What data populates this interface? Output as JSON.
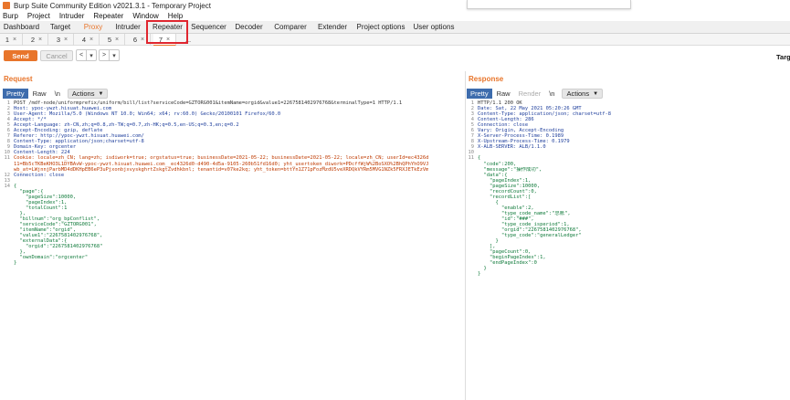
{
  "window": {
    "title": "Burp Suite Community Edition v2021.3.1 - Temporary Project"
  },
  "menu": [
    "Burp",
    "Project",
    "Intruder",
    "Repeater",
    "Window",
    "Help"
  ],
  "top_tabs": [
    {
      "label": "Dashboard"
    },
    {
      "label": "Target"
    },
    {
      "label": "Proxy"
    },
    {
      "label": "Intruder"
    },
    {
      "label": "Repeater"
    },
    {
      "label": "Sequencer"
    },
    {
      "label": "Decoder"
    },
    {
      "label": "Comparer"
    },
    {
      "label": "Extender"
    },
    {
      "label": "Project options"
    },
    {
      "label": "User options"
    }
  ],
  "repeater_tabs": [
    {
      "label": "1",
      "close": "×"
    },
    {
      "label": "2",
      "close": "×"
    },
    {
      "label": "3",
      "close": "×"
    },
    {
      "label": "4",
      "close": "×"
    },
    {
      "label": "5",
      "close": "×"
    },
    {
      "label": "6",
      "close": "×"
    },
    {
      "label": "7",
      "close": "×"
    },
    {
      "label": "...",
      "close": ""
    }
  ],
  "controls": {
    "send": "Send",
    "cancel": "Cancel",
    "back": "<",
    "back_menu": "▾",
    "forward": ">",
    "forward_menu": "▾",
    "target": "Targ"
  },
  "request": {
    "title": "Request",
    "tabs": [
      "Pretty",
      "Raw",
      "\\n"
    ],
    "actions": "Actions",
    "lines": [
      "POST /mdf-node/uniformprefix/uniform/bill/list?serviceCode=GZTORG001&itemName=orgid&value1=2267581402976768&terminalType=1 HTTP/1.1",
      "Host: ypoc-ywzt.hisuat.huawei.com",
      "User-Agent: Mozilla/5.0 (Windows NT 10.0; Win64; x64; rv:60.0) Gecko/20100101 Firefox/60.0",
      "Accept: */*",
      "Accept-Language: zh-CN,zh;q=0.8,zh-TW;q=0.7,zh-HK;q=0.5,en-US;q=0.3,en;q=0.2",
      "Accept-Encoding: gzip, deflate",
      "Referer: http://ypoc-ywzt.hisuat.huawei.com/",
      "Content-Type: application/json;charset=utf-8",
      "Domain-Key: orgcenter",
      "Content-Length: 224",
      "Cookie: locale=zh_CN; lang=zh; isdiwork=true; orgstatus=true; businessDate=2021-05-22; businessDate=2021-05-22; locale=zh_CN; userId=ec4326d",
      "11=Bb5cTKBeKHO3L1DYBAvW-ypoc-ywzt.hisuat.huawei.com__ec4326d0-d490-4d5a-9105-260b51fd16d0; yht_usertoken_diwork=PDcffWjW%2BoSXO%2BhQPhYhO9VJ",
      "wb_at=LWjnnjParbMD4dDKHpEB6eP3uPjxonbjxvyskghrtZskgtZvdhkbnl; tenantid=v07ke2kq; yht_token=bttYn1Z71pFozMzdU5veXRDQkVYRm5MVG1NZk5FRXJETkEzVm",
      "Connection: close",
      "",
      "{",
      "  \"page\":{",
      "    \"pageSize\":10000,",
      "    \"pageIndex\":1,",
      "    \"totalCount\":1",
      "  },",
      "  \"billnum\":\"org_bpConflist\",",
      "  \"serviceCode\":\"GZTORG001\",",
      "  \"itemName\":\"orgid\",",
      "  \"value1\":\"2267581402976768\",",
      "  \"externalData\":{",
      "    \"orgid\":\"2267581402976768\"",
      "  },",
      "  \"ownDomain\":\"orgcenter\"",
      "}"
    ],
    "line_numbers": [
      "1",
      "2",
      "3",
      "4",
      "5",
      "6",
      "7",
      "8",
      "9",
      "10",
      "11",
      "",
      "",
      "12",
      "13",
      "14",
      "",
      "",
      "",
      "",
      "",
      "",
      "",
      "",
      "",
      "",
      "",
      "",
      "",
      "",
      ""
    ]
  },
  "response": {
    "title": "Response",
    "tabs": [
      "Pretty",
      "Raw",
      "Render",
      "\\n"
    ],
    "actions": "Actions",
    "lines": [
      "HTTP/1.1 200 OK",
      "Date: Sat, 22 May 2021 05:20:26 GMT",
      "Content-Type: application/json; charset=utf-8",
      "Content-Length: 286",
      "Connection: close",
      "Vary: Origin, Accept-Encoding",
      "X-Server-Process-Time: 0.1989",
      "X-Upstream-Process-Time: 0.1979",
      "X-ALB-SERVER: ALB/1.1.0",
      "",
      "{",
      "  \"code\":200,",
      "  \"message\":\"操作成功\",",
      "  \"data\":{",
      "    \"pageIndex\":1,",
      "    \"pageSize\":10000,",
      "    \"recordCount\":0,",
      "    \"recordList\":[",
      "      {",
      "        \"enable\":2,",
      "        \"type_code_name\":\"总账\",",
      "        \"id\":\"###\",",
      "        \"type_code_isperiod\":1,",
      "        \"orgid\":\"2267581402976768\",",
      "        \"type_code\":\"generalLedger\"",
      "      }",
      "    ],",
      "    \"pageCount\":0,",
      "    \"beginPageIndex\":1,",
      "    \"endPageIndex\":0",
      "  }",
      "}"
    ],
    "line_numbers": [
      "1",
      "2",
      "3",
      "4",
      "5",
      "6",
      "7",
      "8",
      "9",
      "10",
      "11",
      "",
      "",
      "",
      "",
      "",
      "",
      "",
      "",
      "",
      "",
      "",
      "",
      "",
      "",
      "",
      "",
      "",
      "",
      "",
      "",
      ""
    ]
  }
}
